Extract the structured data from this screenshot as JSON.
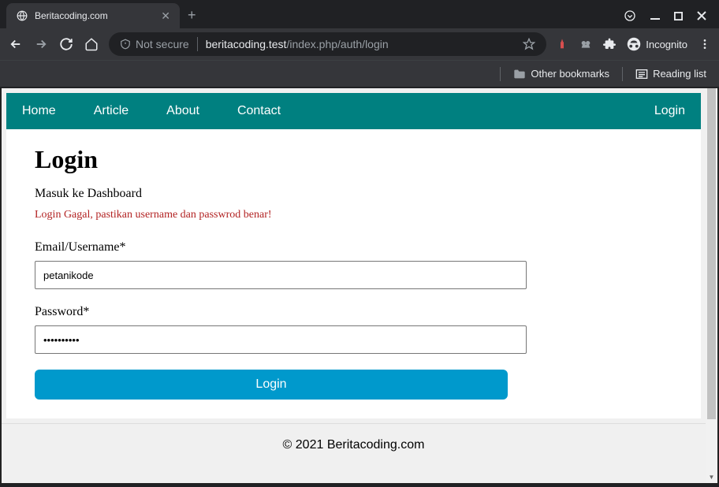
{
  "browser": {
    "tab_title": "Beritacoding.com",
    "url_security": "Not secure",
    "url_domain": "beritacoding.test",
    "url_path": "/index.php/auth/login",
    "incognito_label": "Incognito",
    "other_bookmarks": "Other bookmarks",
    "reading_list": "Reading list"
  },
  "nav": {
    "items": [
      "Home",
      "Article",
      "About",
      "Contact"
    ],
    "right": "Login"
  },
  "page": {
    "title": "Login",
    "subtitle": "Masuk ke Dashboard",
    "error": "Login Gagal, pastikan username dan passwrod benar!",
    "username_label": "Email/Username*",
    "username_value": "petanikode",
    "password_label": "Password*",
    "password_value": "••••••••••",
    "submit_label": "Login"
  },
  "footer": {
    "text": "© 2021 Beritacoding.com"
  }
}
